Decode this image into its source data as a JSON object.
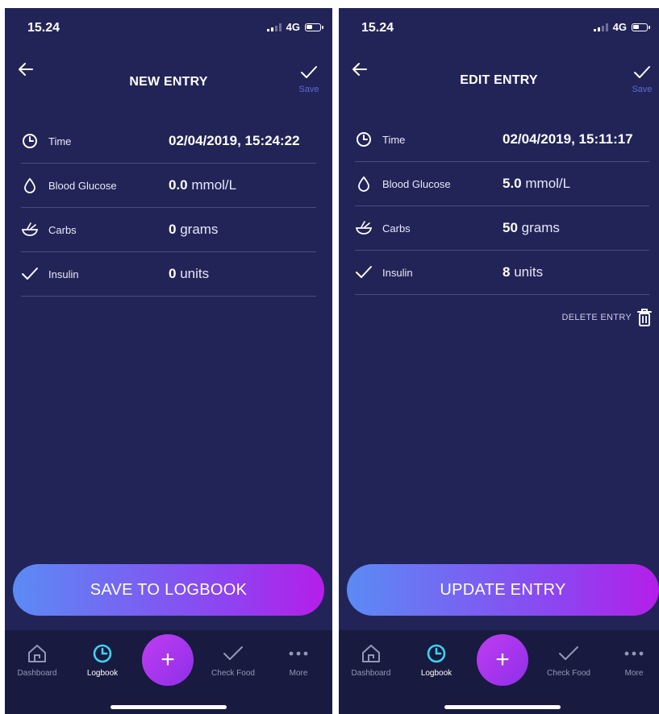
{
  "left": {
    "status": {
      "time": "15.24",
      "network": "4G"
    },
    "header": {
      "title": "NEW ENTRY",
      "save_label": "Save"
    },
    "rows": {
      "time": {
        "label": "Time",
        "value": "02/04/2019, 15:24:22"
      },
      "glucose": {
        "label": "Blood Glucose",
        "value": "0.0",
        "unit": "mmol/L"
      },
      "carbs": {
        "label": "Carbs",
        "value": "0",
        "unit": "grams"
      },
      "insulin": {
        "label": "Insulin",
        "value": "0",
        "unit": "units"
      }
    },
    "cta_label": "SAVE TO LOGBOOK"
  },
  "right": {
    "status": {
      "time": "15.24",
      "network": "4G"
    },
    "header": {
      "title": "EDIT ENTRY",
      "save_label": "Save"
    },
    "rows": {
      "time": {
        "label": "Time",
        "value": "02/04/2019, 15:11:17"
      },
      "glucose": {
        "label": "Blood Glucose",
        "value": "5.0",
        "unit": "mmol/L"
      },
      "carbs": {
        "label": "Carbs",
        "value": "50",
        "unit": "grams"
      },
      "insulin": {
        "label": "Insulin",
        "value": "8",
        "unit": "units"
      }
    },
    "delete_label": "DELETE ENTRY",
    "cta_label": "UPDATE ENTRY"
  },
  "tabbar": {
    "dashboard": "Dashboard",
    "logbook": "Logbook",
    "add": "+",
    "check_food": "Check Food",
    "more": "More"
  },
  "icons": [
    "back-arrow-icon",
    "checkmark-icon",
    "clock-icon",
    "drop-icon",
    "bowl-icon",
    "check-icon",
    "trash-icon",
    "home-icon",
    "logbook-clock-icon",
    "plus-icon",
    "more-dots-icon"
  ],
  "colors": {
    "background": "#222458",
    "tabbar": "#181a3f",
    "accent_cyan": "#3ed3f0",
    "save_blue": "#5c6bd4",
    "cta_start": "#5b8bf4",
    "cta_end": "#b51ee9",
    "fab": "#c03df2"
  }
}
